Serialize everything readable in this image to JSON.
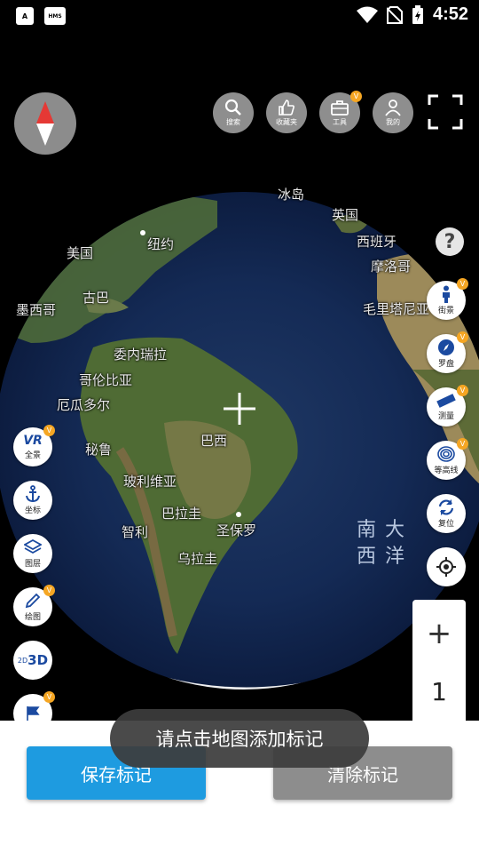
{
  "status_bar": {
    "time": "4:52",
    "notif_a": "A",
    "notif_hms": "HMS"
  },
  "top_toolbar": {
    "search_label": "搜索",
    "favorites_label": "收藏夹",
    "tools_label": "工具",
    "profile_label": "我的",
    "vip_badge": "V"
  },
  "map": {
    "labels": {
      "bingdao": "冰岛",
      "yingguo": "英国",
      "xibanya": "西班牙",
      "moluoge": "摩洛哥",
      "maolitaniya": "毛里塔尼亚",
      "niuyue": "纽约",
      "meiguo": "美国",
      "guba": "古巴",
      "moxige": "墨西哥",
      "weineiruila": "委内瑞拉",
      "gelunbiya": "哥伦比亚",
      "eguaduoer": "厄瓜多尔",
      "bilu": "秘鲁",
      "baxi": "巴西",
      "boliweiya": "玻利维亚",
      "balagui": "巴拉圭",
      "zhili": "智利",
      "shengbaoluo": "圣保罗",
      "wulagui": "乌拉圭"
    },
    "ocean_line1": "南大",
    "ocean_line2": "西洋"
  },
  "right_tools": {
    "street_view": "街景",
    "compass": "罗盘",
    "measure": "测量",
    "contour": "等高线",
    "reset": "复位"
  },
  "left_tools": {
    "vr_text": "VR",
    "panorama": "全景",
    "coordinates": "坐标",
    "layers": "图层",
    "drawing": "绘图",
    "mode_2d": "2D",
    "mode_3d": "3D"
  },
  "zoom": {
    "plus": "+",
    "level": "1"
  },
  "actions": {
    "save_label": "保存标记",
    "clear_label": "清除标记"
  },
  "toast": {
    "message": "请点击地图添加标记"
  },
  "help_symbol": "?",
  "colors": {
    "save_button": "#1e9be0",
    "clear_button": "#8d8d8d",
    "vip_badge": "#f5a623",
    "tool_icon": "#1b4aa0"
  }
}
